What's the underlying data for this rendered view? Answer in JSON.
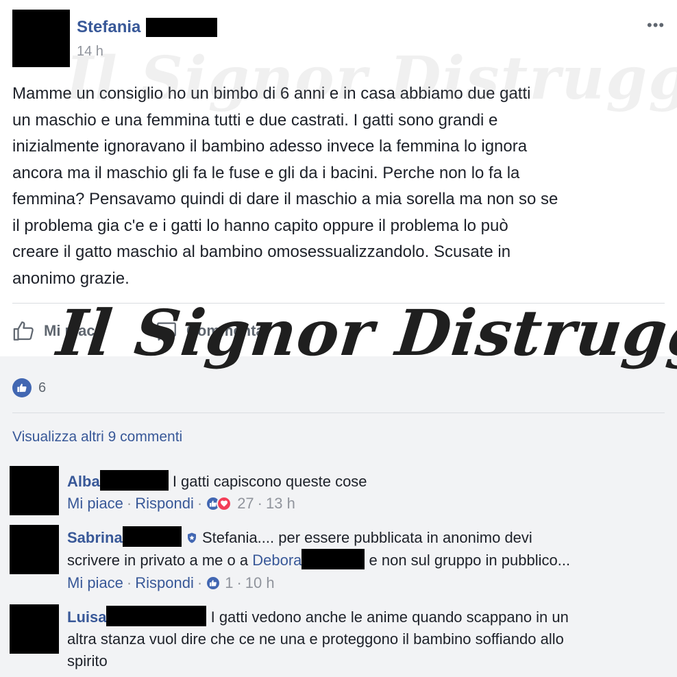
{
  "post": {
    "author_name": "Stefania",
    "timestamp": "14 h",
    "more_label": "•••",
    "text_lines": [
      "Mamme un consiglio ho un bimbo di 6 anni e in casa abbiamo due gatti",
      "un maschio e una femmina tutti e due castrati. I gatti sono grandi e",
      "inizialmente ignoravano il bambino adesso invece la femmina lo ignora",
      "ancora ma il maschio gli fa le fuse e gli da i bacini. Perche non lo fa la",
      "femmina? Pensavamo quindi di dare il maschio a mia sorella ma non so se",
      "il problema gia c'e e i gatti lo hanno capito oppure il problema lo può",
      "creare il gatto maschio al bambino omosessualizzandolo. Scusate in",
      "anonimo grazie."
    ]
  },
  "actions": {
    "like_label": "Mi piace",
    "like_icon": "thumbs-up-outline-icon",
    "comment_label": "Commenta",
    "comment_icon": "comment-bubble-icon"
  },
  "reactions": {
    "count": "6",
    "icon": "like-reaction-icon"
  },
  "view_more_comments": "Visualizza altri 9 commenti",
  "comments": [
    {
      "name": "Alba",
      "text_lines": [
        "I gatti capiscono queste cose"
      ],
      "like_label": "Mi piace",
      "reply_label": "Rispondi",
      "reactions_count": "27",
      "time": "13 h"
    },
    {
      "name": "Sabrina",
      "badge_icon": "admin-shield-icon",
      "text_line1": "Stefania.... per essere pubblicata in anonimo devi",
      "text_line2_a": "scrivere in privato a me o a",
      "mention": "Debora",
      "text_line2_b": "e non sul gruppo in pubblico...",
      "like_label": "Mi piace",
      "reply_label": "Rispondi",
      "reactions_count": "1",
      "time": "10 h"
    },
    {
      "name": "Luisa",
      "text_lines": [
        "I gatti vedono anche le anime quando scappano in un",
        "altra stanza vuol dire che ce ne una e proteggono il bambino soffiando allo",
        "spirito"
      ]
    }
  ],
  "watermark": {
    "text": "Il Signor Distruggere"
  },
  "colors": {
    "link_blue": "#385898",
    "like_blue": "#4267b2",
    "heart_red": "#f33e58",
    "comment_bg": "#f2f3f5",
    "meta_gray": "#90949c"
  }
}
